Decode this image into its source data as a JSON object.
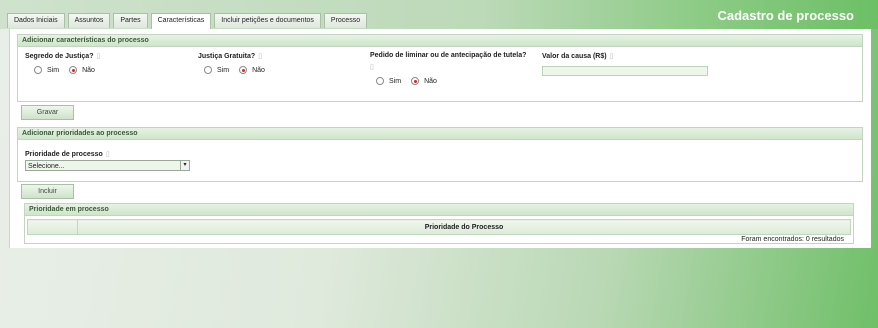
{
  "header": {
    "title": "Cadastro de processo",
    "tabs": [
      {
        "label": "Dados Iniciais"
      },
      {
        "label": "Assuntos"
      },
      {
        "label": "Partes"
      },
      {
        "label": "Características"
      },
      {
        "label": "Incluir petições e documentos"
      },
      {
        "label": "Processo"
      }
    ],
    "active_tab": "Características"
  },
  "characteristics": {
    "heading": "Adicionar características do processo",
    "segredo": {
      "label": "Segredo de Justiça?",
      "option_yes": "Sim",
      "option_no": "Não",
      "selected": "Não"
    },
    "gratuita": {
      "label": "Justiça Gratuita?",
      "option_yes": "Sim",
      "option_no": "Não",
      "selected": "Não"
    },
    "liminar": {
      "label": "Pedido de liminar ou de antecipação de tutela?",
      "option_yes": "Sim",
      "option_no": "Não",
      "selected": "Não"
    },
    "valor_causa": {
      "label": "Valor da causa (R$)",
      "value": ""
    },
    "save_button": "Gravar"
  },
  "priorities": {
    "heading": "Adicionar prioridades ao processo",
    "field_label": "Prioridade de processo",
    "select_value": "Selecione...",
    "add_button": "Incluir",
    "list_heading": "Prioridade em processo",
    "column_header": "Prioridade do Processo",
    "result_text": "Foram encontrados: 0 resultados"
  },
  "colors": {
    "accent_green": "#6dbf66",
    "panel_header": "#cfe5ca",
    "radio_selected": "#e02020"
  }
}
